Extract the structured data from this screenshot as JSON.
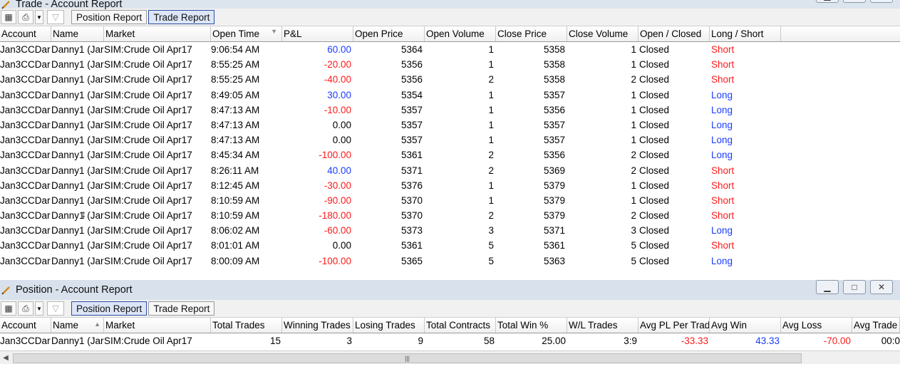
{
  "trade_window": {
    "title": "Trade - Account Report",
    "toolbar": {
      "tabs": [
        "Position Report",
        "Trade Report"
      ],
      "active_tab": "Trade Report"
    },
    "columns": [
      "Account",
      "Name",
      "Market",
      "Open Time",
      "P&L",
      "Open Price",
      "Open Volume",
      "Close Price",
      "Close Volume",
      "Open / Closed",
      "Long / Short"
    ],
    "rows": [
      {
        "account": "Jan3CCDar",
        "name": "Danny1 (Jar",
        "market": "SIM:Crude Oil Apr17",
        "open_time": "9:06:54 AM",
        "pl": "60.00",
        "pl_sign": "pos",
        "open_price": "5364",
        "open_volume": "1",
        "close_price": "5358",
        "close_volume": "1",
        "open_closed": "Closed",
        "long_short": "Short"
      },
      {
        "account": "Jan3CCDar",
        "name": "Danny1 (Jar",
        "market": "SIM:Crude Oil Apr17",
        "open_time": "8:55:25 AM",
        "pl": "-20.00",
        "pl_sign": "neg",
        "open_price": "5356",
        "open_volume": "1",
        "close_price": "5358",
        "close_volume": "1",
        "open_closed": "Closed",
        "long_short": "Short"
      },
      {
        "account": "Jan3CCDar",
        "name": "Danny1 (Jar",
        "market": "SIM:Crude Oil Apr17",
        "open_time": "8:55:25 AM",
        "pl": "-40.00",
        "pl_sign": "neg",
        "open_price": "5356",
        "open_volume": "2",
        "close_price": "5358",
        "close_volume": "2",
        "open_closed": "Closed",
        "long_short": "Short"
      },
      {
        "account": "Jan3CCDar",
        "name": "Danny1 (Jar",
        "market": "SIM:Crude Oil Apr17",
        "open_time": "8:49:05 AM",
        "pl": "30.00",
        "pl_sign": "pos",
        "open_price": "5354",
        "open_volume": "1",
        "close_price": "5357",
        "close_volume": "1",
        "open_closed": "Closed",
        "long_short": "Long"
      },
      {
        "account": "Jan3CCDar",
        "name": "Danny1 (Jar",
        "market": "SIM:Crude Oil Apr17",
        "open_time": "8:47:13 AM",
        "pl": "-10.00",
        "pl_sign": "neg",
        "open_price": "5357",
        "open_volume": "1",
        "close_price": "5356",
        "close_volume": "1",
        "open_closed": "Closed",
        "long_short": "Long"
      },
      {
        "account": "Jan3CCDar",
        "name": "Danny1 (Jar",
        "market": "SIM:Crude Oil Apr17",
        "open_time": "8:47:13 AM",
        "pl": "0.00",
        "pl_sign": "zero",
        "open_price": "5357",
        "open_volume": "1",
        "close_price": "5357",
        "close_volume": "1",
        "open_closed": "Closed",
        "long_short": "Long"
      },
      {
        "account": "Jan3CCDar",
        "name": "Danny1 (Jar",
        "market": "SIM:Crude Oil Apr17",
        "open_time": "8:47:13 AM",
        "pl": "0.00",
        "pl_sign": "zero",
        "open_price": "5357",
        "open_volume": "1",
        "close_price": "5357",
        "close_volume": "1",
        "open_closed": "Closed",
        "long_short": "Long"
      },
      {
        "account": "Jan3CCDar",
        "name": "Danny1 (Jar",
        "market": "SIM:Crude Oil Apr17",
        "open_time": "8:45:34 AM",
        "pl": "-100.00",
        "pl_sign": "neg",
        "open_price": "5361",
        "open_volume": "2",
        "close_price": "5356",
        "close_volume": "2",
        "open_closed": "Closed",
        "long_short": "Long"
      },
      {
        "account": "Jan3CCDar",
        "name": "Danny1 (Jar",
        "market": "SIM:Crude Oil Apr17",
        "open_time": "8:26:11 AM",
        "pl": "40.00",
        "pl_sign": "pos",
        "open_price": "5371",
        "open_volume": "2",
        "close_price": "5369",
        "close_volume": "2",
        "open_closed": "Closed",
        "long_short": "Short"
      },
      {
        "account": "Jan3CCDar",
        "name": "Danny1 (Jar",
        "market": "SIM:Crude Oil Apr17",
        "open_time": "8:12:45 AM",
        "pl": "-30.00",
        "pl_sign": "neg",
        "open_price": "5376",
        "open_volume": "1",
        "close_price": "5379",
        "close_volume": "1",
        "open_closed": "Closed",
        "long_short": "Short"
      },
      {
        "account": "Jan3CCDar",
        "name": "Danny1 (Jar",
        "market": "SIM:Crude Oil Apr17",
        "open_time": "8:10:59 AM",
        "pl": "-90.00",
        "pl_sign": "neg",
        "open_price": "5370",
        "open_volume": "1",
        "close_price": "5379",
        "close_volume": "1",
        "open_closed": "Closed",
        "long_short": "Short"
      },
      {
        "account": "Jan3CCDar",
        "name": "Danny1 (Jar",
        "market": "SIM:Crude Oil Apr17",
        "open_time": "8:10:59 AM",
        "pl": "-180.00",
        "pl_sign": "neg",
        "open_price": "5370",
        "open_volume": "2",
        "close_price": "5379",
        "close_volume": "2",
        "open_closed": "Closed",
        "long_short": "Short"
      },
      {
        "account": "Jan3CCDar",
        "name": "Danny1 (Jar",
        "market": "SIM:Crude Oil Apr17",
        "open_time": "8:06:02 AM",
        "pl": "-60.00",
        "pl_sign": "neg",
        "open_price": "5373",
        "open_volume": "3",
        "close_price": "5371",
        "close_volume": "3",
        "open_closed": "Closed",
        "long_short": "Long"
      },
      {
        "account": "Jan3CCDar",
        "name": "Danny1 (Jar",
        "market": "SIM:Crude Oil Apr17",
        "open_time": "8:01:01 AM",
        "pl": "0.00",
        "pl_sign": "zero",
        "open_price": "5361",
        "open_volume": "5",
        "close_price": "5361",
        "close_volume": "5",
        "open_closed": "Closed",
        "long_short": "Short"
      },
      {
        "account": "Jan3CCDar",
        "name": "Danny1 (Jar",
        "market": "SIM:Crude Oil Apr17",
        "open_time": "8:00:09 AM",
        "pl": "-100.00",
        "pl_sign": "neg",
        "open_price": "5365",
        "open_volume": "5",
        "close_price": "5363",
        "close_volume": "5",
        "open_closed": "Closed",
        "long_short": "Long"
      }
    ]
  },
  "position_window": {
    "title": "Position - Account Report",
    "toolbar": {
      "tabs": [
        "Position Report",
        "Trade Report"
      ],
      "active_tab": "Position Report"
    },
    "columns": [
      "Account",
      "Name",
      "Market",
      "Total Trades",
      "Winning Trades",
      "Losing Trades",
      "Total Contracts",
      "Total Win %",
      "W/L Trades",
      "Avg PL Per Trade",
      "Avg Win",
      "Avg Loss",
      "Avg Trade"
    ],
    "row": {
      "account": "Jan3CCDar",
      "name": "Danny1 (Jar",
      "market": "SIM:Crude Oil Apr17",
      "total_trades": "15",
      "winning_trades": "3",
      "losing_trades": "9",
      "total_contracts": "58",
      "total_win_pct": "25.00",
      "wl_trades": "3:9",
      "avg_pl": "-33.33",
      "avg_win": "43.33",
      "avg_loss": "-70.00",
      "avg_trade": "00:0"
    }
  },
  "colors": {
    "negative": "#ff1a1a",
    "positive": "#1a3cff",
    "active_tab_border": "#2b4ea6"
  }
}
